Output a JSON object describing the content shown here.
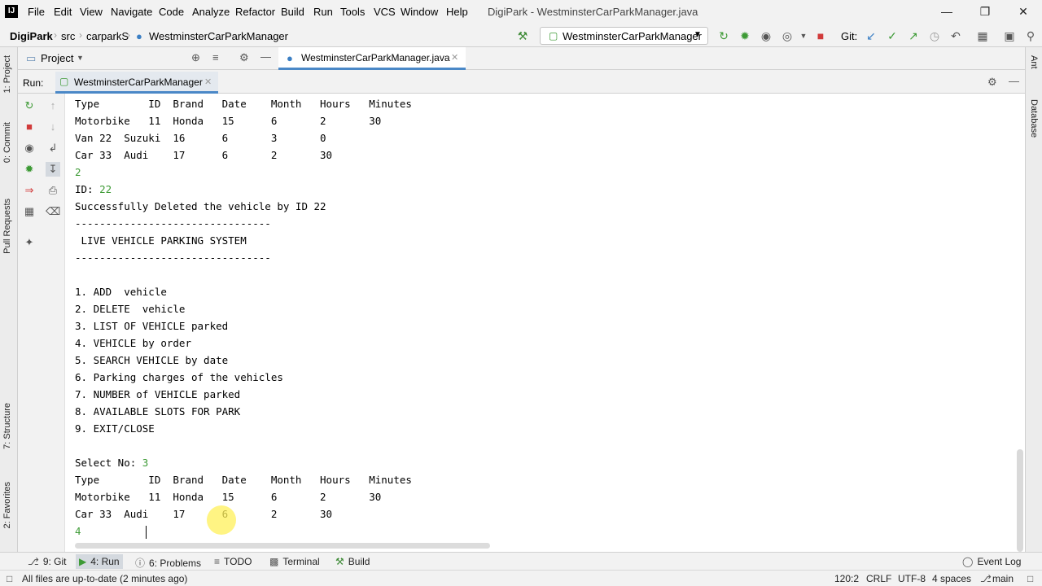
{
  "app": {
    "window_title": "DigiPark - WestminsterCarParkManager.java",
    "menu": [
      "File",
      "Edit",
      "View",
      "Navigate",
      "Code",
      "Analyze",
      "Refactor",
      "Build",
      "Run",
      "Tools",
      "VCS",
      "Window",
      "Help"
    ]
  },
  "breadcrumb": {
    "project": "DigiPark",
    "folder1": "src",
    "folder2": "carparkS",
    "file": "WestminsterCarParkManager"
  },
  "toolbar": {
    "run_config": "WestminsterCarParkManager",
    "git_label": "Git:"
  },
  "project_panel": {
    "label": "Project",
    "editor_tab": "WestminsterCarParkManager.java"
  },
  "run_panel": {
    "label": "Run:",
    "tab": "WestminsterCarParkManager"
  },
  "left_tabs": {
    "project": "1: Project",
    "commit": "0: Commit",
    "pull_requests": "Pull Requests",
    "structure": "7: Structure",
    "favorites": "2: Favorites"
  },
  "right_tabs": {
    "ant": "Ant",
    "database": "Database"
  },
  "console": {
    "lines": [
      {
        "text": "Type        ID  Brand   Date    Month   Hours   Minutes",
        "input": false
      },
      {
        "text": "Motorbike   11  Honda   15      6       2       30",
        "input": false
      },
      {
        "text": "Van 22  Suzuki  16      6       3       0",
        "input": false
      },
      {
        "text": "Car 33  Audi    17      6       2       30",
        "input": false
      },
      {
        "text": "2",
        "input": true
      },
      {
        "text": "ID: ",
        "input": false,
        "suffix": "22"
      },
      {
        "text": "Successfully Deleted the vehicle by ID 22",
        "input": false
      },
      {
        "text": "--------------------------------",
        "input": false
      },
      {
        "text": " LIVE VEHICLE PARKING SYSTEM",
        "input": false
      },
      {
        "text": "--------------------------------",
        "input": false
      },
      {
        "text": "",
        "input": false
      },
      {
        "text": "1. ADD  vehicle",
        "input": false
      },
      {
        "text": "2. DELETE  vehicle",
        "input": false
      },
      {
        "text": "3. LIST OF VEHICLE parked",
        "input": false
      },
      {
        "text": "4. VEHICLE by order",
        "input": false
      },
      {
        "text": "5. SEARCH VEHICLE by date",
        "input": false
      },
      {
        "text": "6. Parking charges of the vehicles",
        "input": false
      },
      {
        "text": "7. NUMBER of VEHICLE parked",
        "input": false
      },
      {
        "text": "8. AVAILABLE SLOTS FOR PARK",
        "input": false
      },
      {
        "text": "9. EXIT/CLOSE",
        "input": false
      },
      {
        "text": "",
        "input": false
      },
      {
        "text": "Select No: ",
        "input": false,
        "suffix": "3"
      },
      {
        "text": "Type        ID  Brand   Date    Month   Hours   Minutes",
        "input": false
      },
      {
        "text": "Motorbike   11  Honda   15      6       2       30",
        "input": false
      },
      {
        "text": "Car 33  Audi    17      6       2       30",
        "input": false
      },
      {
        "text": "4",
        "input": true
      }
    ]
  },
  "bottom_tabs": {
    "git": "9: Git",
    "run": "4: Run",
    "problems": "6: Problems",
    "todo": "TODO",
    "terminal": "Terminal",
    "build": "Build",
    "event_log": "Event Log"
  },
  "status": {
    "message": "All files are up-to-date (2 minutes ago)",
    "position": "120:2",
    "line_sep": "CRLF",
    "encoding": "UTF-8",
    "indent": "4 spaces",
    "branch": "main"
  },
  "colors": {
    "input_text": "#3d9a35",
    "accent": "#4a88c7"
  }
}
